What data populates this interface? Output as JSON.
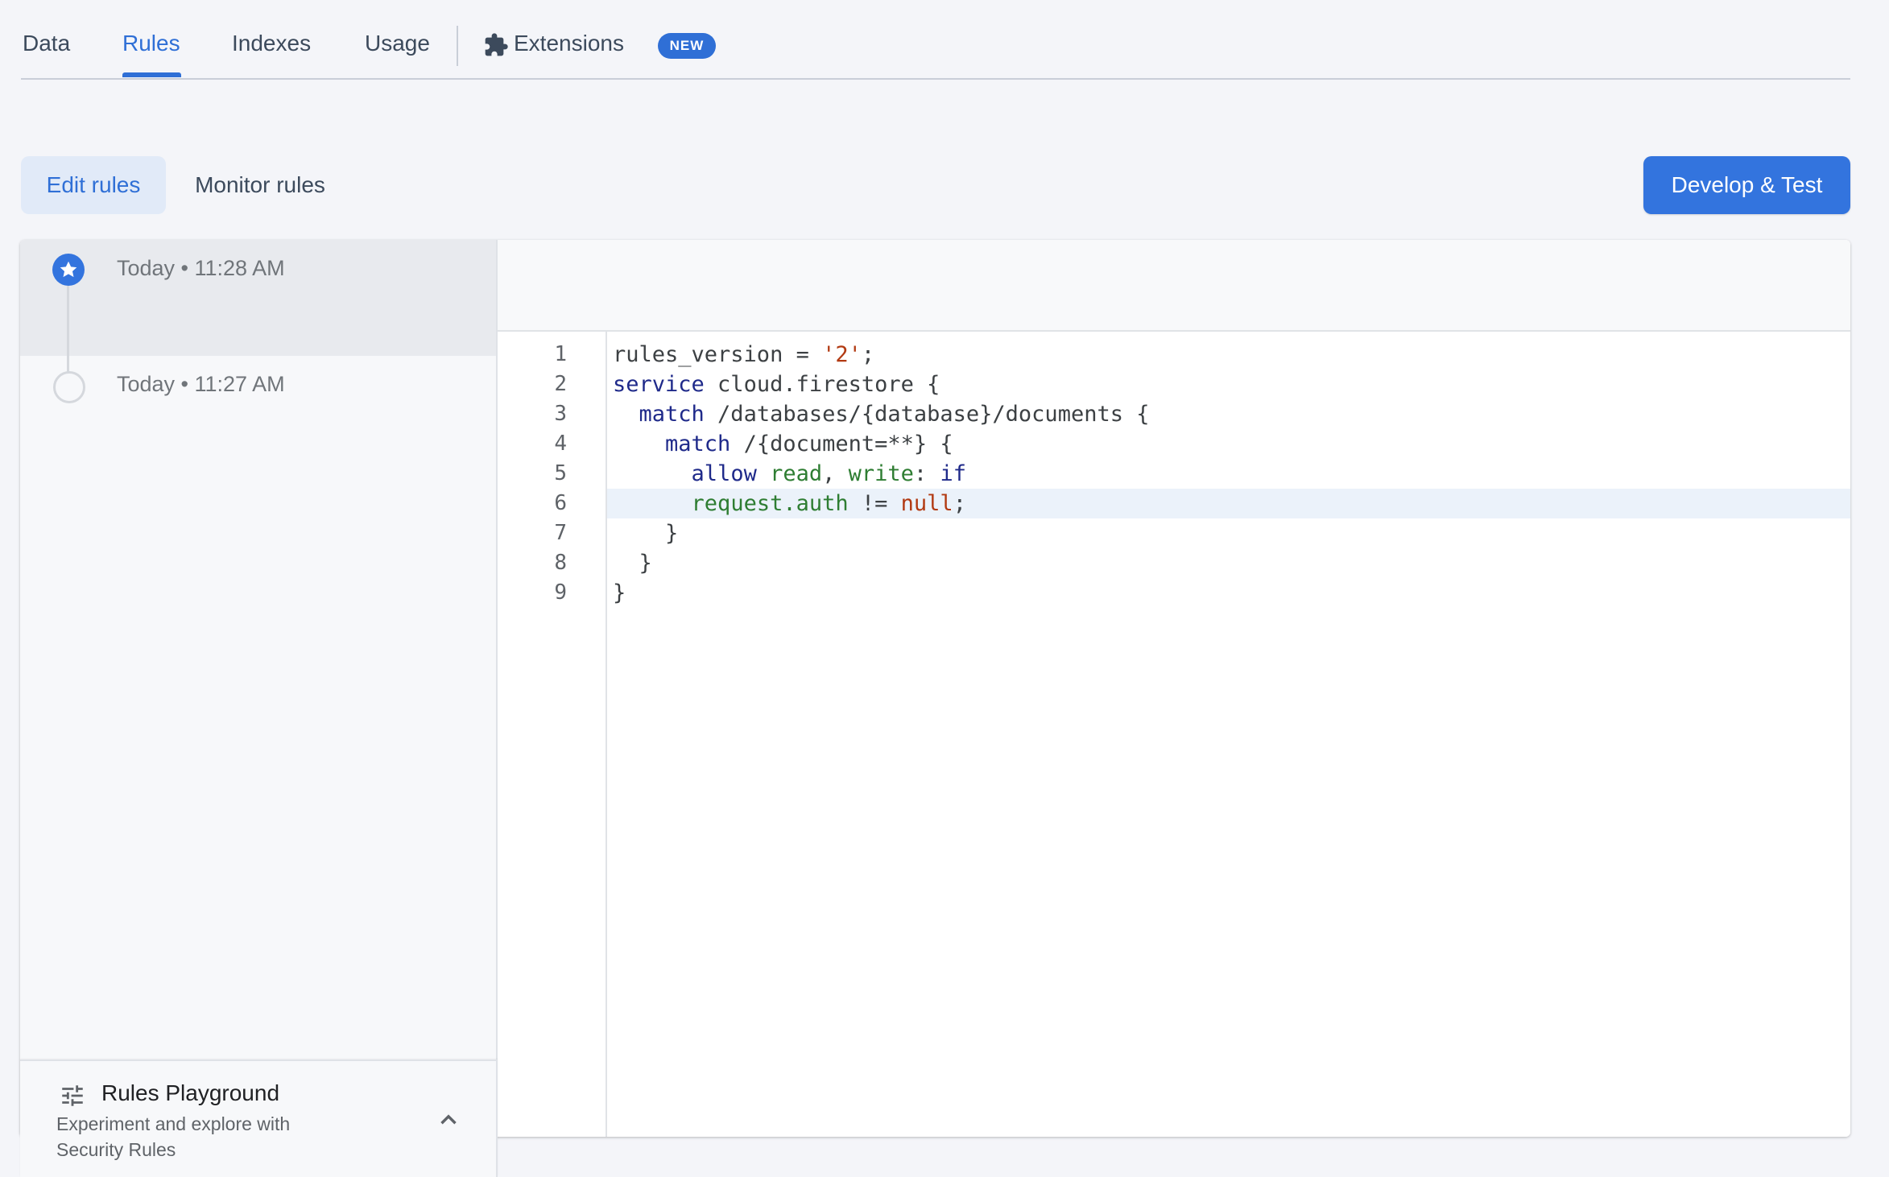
{
  "nav": {
    "tabs": [
      "Data",
      "Rules",
      "Indexes",
      "Usage"
    ],
    "extensions_label": "Extensions",
    "badge": "NEW",
    "active_tab": "Rules"
  },
  "subnav": {
    "edit": "Edit rules",
    "monitor": "Monitor rules",
    "develop": "Develop & Test"
  },
  "history": [
    {
      "time": "Today • 11:28 AM",
      "current": true
    },
    {
      "time": "Today • 11:27 AM",
      "current": false
    }
  ],
  "editor": {
    "line_numbers": [
      "1",
      "2",
      "3",
      "4",
      "5",
      "6",
      "7",
      "8",
      "9"
    ],
    "highlighted_line": 6
  },
  "playground": {
    "title": "Rules Playground",
    "desc_line1": "Experiment and explore with",
    "desc_line2": "Security Rules"
  },
  "colors": {
    "accent": "#2f6fd6",
    "button": "#3374de",
    "keyword": "#1f2a8a",
    "string": "#b23a12",
    "identifier": "#2e7d32",
    "highlight_line": "#ebf2fa"
  }
}
